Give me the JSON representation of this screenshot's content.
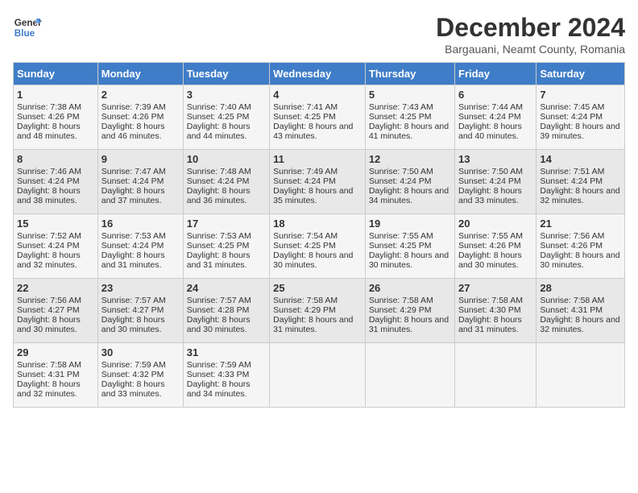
{
  "logo": {
    "line1": "General",
    "line2": "Blue"
  },
  "title": "December 2024",
  "subtitle": "Bargauani, Neamt County, Romania",
  "days_of_week": [
    "Sunday",
    "Monday",
    "Tuesday",
    "Wednesday",
    "Thursday",
    "Friday",
    "Saturday"
  ],
  "weeks": [
    [
      {
        "day": "1",
        "sunrise": "7:38 AM",
        "sunset": "4:26 PM",
        "daylight": "8 hours and 48 minutes."
      },
      {
        "day": "2",
        "sunrise": "7:39 AM",
        "sunset": "4:26 PM",
        "daylight": "8 hours and 46 minutes."
      },
      {
        "day": "3",
        "sunrise": "7:40 AM",
        "sunset": "4:25 PM",
        "daylight": "8 hours and 44 minutes."
      },
      {
        "day": "4",
        "sunrise": "7:41 AM",
        "sunset": "4:25 PM",
        "daylight": "8 hours and 43 minutes."
      },
      {
        "day": "5",
        "sunrise": "7:43 AM",
        "sunset": "4:25 PM",
        "daylight": "8 hours and 41 minutes."
      },
      {
        "day": "6",
        "sunrise": "7:44 AM",
        "sunset": "4:24 PM",
        "daylight": "8 hours and 40 minutes."
      },
      {
        "day": "7",
        "sunrise": "7:45 AM",
        "sunset": "4:24 PM",
        "daylight": "8 hours and 39 minutes."
      }
    ],
    [
      {
        "day": "8",
        "sunrise": "7:46 AM",
        "sunset": "4:24 PM",
        "daylight": "8 hours and 38 minutes."
      },
      {
        "day": "9",
        "sunrise": "7:47 AM",
        "sunset": "4:24 PM",
        "daylight": "8 hours and 37 minutes."
      },
      {
        "day": "10",
        "sunrise": "7:48 AM",
        "sunset": "4:24 PM",
        "daylight": "8 hours and 36 minutes."
      },
      {
        "day": "11",
        "sunrise": "7:49 AM",
        "sunset": "4:24 PM",
        "daylight": "8 hours and 35 minutes."
      },
      {
        "day": "12",
        "sunrise": "7:50 AM",
        "sunset": "4:24 PM",
        "daylight": "8 hours and 34 minutes."
      },
      {
        "day": "13",
        "sunrise": "7:50 AM",
        "sunset": "4:24 PM",
        "daylight": "8 hours and 33 minutes."
      },
      {
        "day": "14",
        "sunrise": "7:51 AM",
        "sunset": "4:24 PM",
        "daylight": "8 hours and 32 minutes."
      }
    ],
    [
      {
        "day": "15",
        "sunrise": "7:52 AM",
        "sunset": "4:24 PM",
        "daylight": "8 hours and 32 minutes."
      },
      {
        "day": "16",
        "sunrise": "7:53 AM",
        "sunset": "4:24 PM",
        "daylight": "8 hours and 31 minutes."
      },
      {
        "day": "17",
        "sunrise": "7:53 AM",
        "sunset": "4:25 PM",
        "daylight": "8 hours and 31 minutes."
      },
      {
        "day": "18",
        "sunrise": "7:54 AM",
        "sunset": "4:25 PM",
        "daylight": "8 hours and 30 minutes."
      },
      {
        "day": "19",
        "sunrise": "7:55 AM",
        "sunset": "4:25 PM",
        "daylight": "8 hours and 30 minutes."
      },
      {
        "day": "20",
        "sunrise": "7:55 AM",
        "sunset": "4:26 PM",
        "daylight": "8 hours and 30 minutes."
      },
      {
        "day": "21",
        "sunrise": "7:56 AM",
        "sunset": "4:26 PM",
        "daylight": "8 hours and 30 minutes."
      }
    ],
    [
      {
        "day": "22",
        "sunrise": "7:56 AM",
        "sunset": "4:27 PM",
        "daylight": "8 hours and 30 minutes."
      },
      {
        "day": "23",
        "sunrise": "7:57 AM",
        "sunset": "4:27 PM",
        "daylight": "8 hours and 30 minutes."
      },
      {
        "day": "24",
        "sunrise": "7:57 AM",
        "sunset": "4:28 PM",
        "daylight": "8 hours and 30 minutes."
      },
      {
        "day": "25",
        "sunrise": "7:58 AM",
        "sunset": "4:29 PM",
        "daylight": "8 hours and 31 minutes."
      },
      {
        "day": "26",
        "sunrise": "7:58 AM",
        "sunset": "4:29 PM",
        "daylight": "8 hours and 31 minutes."
      },
      {
        "day": "27",
        "sunrise": "7:58 AM",
        "sunset": "4:30 PM",
        "daylight": "8 hours and 31 minutes."
      },
      {
        "day": "28",
        "sunrise": "7:58 AM",
        "sunset": "4:31 PM",
        "daylight": "8 hours and 32 minutes."
      }
    ],
    [
      {
        "day": "29",
        "sunrise": "7:58 AM",
        "sunset": "4:31 PM",
        "daylight": "8 hours and 32 minutes."
      },
      {
        "day": "30",
        "sunrise": "7:59 AM",
        "sunset": "4:32 PM",
        "daylight": "8 hours and 33 minutes."
      },
      {
        "day": "31",
        "sunrise": "7:59 AM",
        "sunset": "4:33 PM",
        "daylight": "8 hours and 34 minutes."
      },
      null,
      null,
      null,
      null
    ]
  ],
  "labels": {
    "sunrise": "Sunrise:",
    "sunset": "Sunset:",
    "daylight": "Daylight:"
  }
}
